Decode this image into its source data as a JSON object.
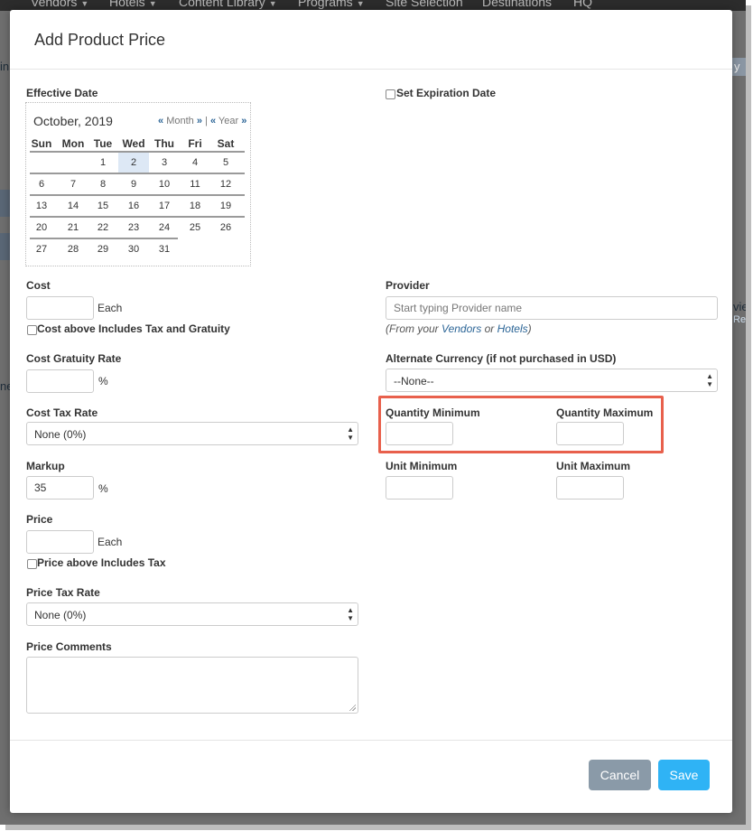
{
  "background_nav": [
    "Vendors",
    "Hotels",
    "Content Library",
    "Programs",
    "Site Selection",
    "Destinations",
    "HQ"
  ],
  "background_fragments": {
    "left_1": "in",
    "left_2": "ne",
    "right_1": "y",
    "right_2": "vie",
    "right_3": "Re"
  },
  "modal": {
    "title": "Add Product Price"
  },
  "effective_date": {
    "label": "Effective Date",
    "calendar": {
      "month_year": "October, 2019",
      "prev_month": "«",
      "month_label": "Month",
      "next_month": "»",
      "separator": "|",
      "prev_year": "«",
      "year_label": "Year",
      "next_year": "»",
      "days_of_week": [
        "Sun",
        "Mon",
        "Tue",
        "Wed",
        "Thu",
        "Fri",
        "Sat"
      ],
      "weeks": [
        [
          "",
          "",
          "1",
          "2",
          "3",
          "4",
          "5"
        ],
        [
          "6",
          "7",
          "8",
          "9",
          "10",
          "11",
          "12"
        ],
        [
          "13",
          "14",
          "15",
          "16",
          "17",
          "18",
          "19"
        ],
        [
          "20",
          "21",
          "22",
          "23",
          "24",
          "25",
          "26"
        ],
        [
          "27",
          "28",
          "29",
          "30",
          "31",
          "",
          ""
        ]
      ],
      "selected_day": "2"
    }
  },
  "set_expiration": {
    "label": "Set Expiration Date",
    "checked": false
  },
  "cost": {
    "label": "Cost",
    "value": "",
    "unit": "Each",
    "includes_tax_label": "Cost above Includes Tax and Gratuity",
    "includes_tax_checked": false
  },
  "cost_gratuity_rate": {
    "label": "Cost Gratuity Rate",
    "value": "",
    "unit": "%"
  },
  "cost_tax_rate": {
    "label": "Cost Tax Rate",
    "selected": "None (0%)"
  },
  "markup": {
    "label": "Markup",
    "value": "35",
    "unit": "%"
  },
  "price": {
    "label": "Price",
    "value": "",
    "unit": "Each",
    "includes_tax_label": "Price above Includes Tax",
    "includes_tax_checked": false
  },
  "price_tax_rate": {
    "label": "Price Tax Rate",
    "selected": "None (0%)"
  },
  "price_comments": {
    "label": "Price Comments",
    "value": ""
  },
  "provider": {
    "label": "Provider",
    "placeholder": "Start typing Provider name",
    "note_prefix": "(From your",
    "note_link_vendors": "Vendors",
    "note_or": "or",
    "note_link_hotels": "Hotels",
    "note_suffix": ")"
  },
  "alternate_currency": {
    "label": "Alternate Currency (if not purchased in USD)",
    "selected": "--None--"
  },
  "quantity_minimum": {
    "label": "Quantity Minimum",
    "value": ""
  },
  "quantity_maximum": {
    "label": "Quantity Maximum",
    "value": ""
  },
  "unit_minimum": {
    "label": "Unit Minimum",
    "value": ""
  },
  "unit_maximum": {
    "label": "Unit Maximum",
    "value": ""
  },
  "footer": {
    "cancel_label": "Cancel",
    "save_label": "Save"
  },
  "colors": {
    "highlight": "#e8604c",
    "save_button": "#2fb3f5",
    "cancel_button": "#8a9aa8",
    "link": "#2a6496"
  }
}
